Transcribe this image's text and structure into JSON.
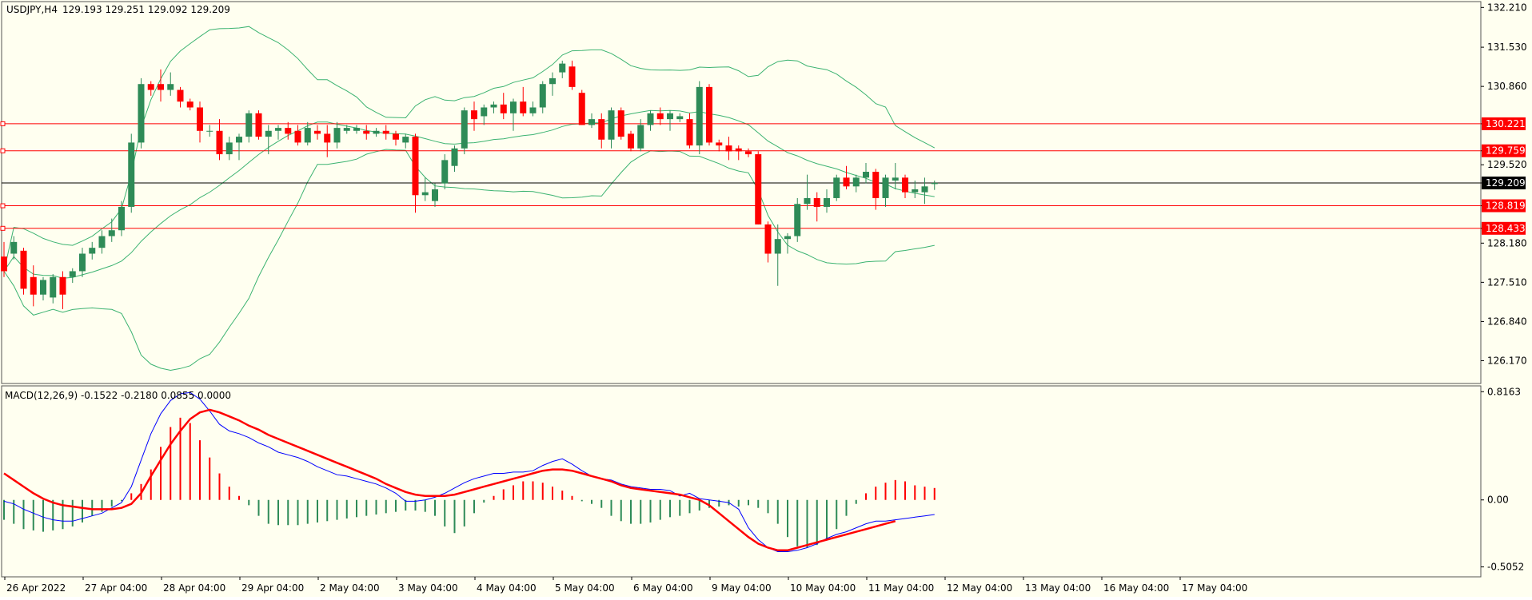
{
  "header": {
    "symbol_tf": "USDJPY,H4",
    "ohlc": "129.193 129.251 129.092 129.209",
    "macd_label": "MACD(12,26,9) -0.1522 -0.2180 0.0855 0.0000"
  },
  "colors": {
    "background": "#fffff0",
    "bull": "#2e8b57",
    "bear": "#ff0000",
    "bollinger": "#3cb371",
    "level_line": "#ff0000",
    "price_line": "#000000",
    "macd_line": "#0000ff",
    "signal_line": "#ff0000"
  },
  "chart_data": [
    {
      "type": "candlestick",
      "title": "USDJPY,H4",
      "ylim": [
        125.78,
        132.31
      ],
      "y_ticks": [
        "132.210",
        "131.530",
        "130.860",
        "130.221",
        "129.759",
        "129.520",
        "129.209",
        "128.819",
        "128.433",
        "128.180",
        "127.510",
        "126.840",
        "126.170"
      ],
      "x_ticks": [
        "26 Apr 2022",
        "27 Apr 04:00",
        "28 Apr 04:00",
        "29 Apr 04:00",
        "2 May 04:00",
        "3 May 04:00",
        "4 May 04:00",
        "5 May 04:00",
        "6 May 04:00",
        "9 May 04:00",
        "10 May 04:00",
        "11 May 04:00",
        "12 May 04:00",
        "13 May 04:00",
        "16 May 04:00",
        "17 May 04:00"
      ],
      "horizontal_levels": [
        {
          "label": "130.221",
          "value": 130.221
        },
        {
          "label": "129.759",
          "value": 129.759
        },
        {
          "label": "128.819",
          "value": 128.819
        },
        {
          "label": "128.433",
          "value": 128.433
        }
      ],
      "current_price": {
        "label": "129.209",
        "value": 129.209
      },
      "candles": [
        [
          127.95,
          128.2,
          127.6,
          127.7
        ],
        [
          128.0,
          128.3,
          127.9,
          128.2
        ],
        [
          128.05,
          128.1,
          127.3,
          127.4
        ],
        [
          127.6,
          127.8,
          127.1,
          127.3
        ],
        [
          127.3,
          127.6,
          127.2,
          127.55
        ],
        [
          127.25,
          127.65,
          127.15,
          127.6
        ],
        [
          127.6,
          127.7,
          127.05,
          127.3
        ],
        [
          127.6,
          127.75,
          127.5,
          127.7
        ],
        [
          127.7,
          128.1,
          127.6,
          128.0
        ],
        [
          128.0,
          128.2,
          127.9,
          128.1
        ],
        [
          128.1,
          128.4,
          128.0,
          128.3
        ],
        [
          128.3,
          128.6,
          128.2,
          128.4
        ],
        [
          128.4,
          128.9,
          128.3,
          128.8
        ],
        [
          128.8,
          130.05,
          128.7,
          129.9
        ],
        [
          129.9,
          131.0,
          129.8,
          130.9
        ],
        [
          130.9,
          130.95,
          130.7,
          130.8
        ],
        [
          130.9,
          131.15,
          130.6,
          130.8
        ],
        [
          130.8,
          131.1,
          130.7,
          130.9
        ],
        [
          130.8,
          130.85,
          130.5,
          130.6
        ],
        [
          130.6,
          130.65,
          130.45,
          130.5
        ],
        [
          130.5,
          130.6,
          129.9,
          130.1
        ],
        [
          130.1,
          130.2,
          130.0,
          130.1
        ],
        [
          130.1,
          130.3,
          129.6,
          129.7
        ],
        [
          129.7,
          130.0,
          129.6,
          129.9
        ],
        [
          129.9,
          130.05,
          129.6,
          130.0
        ],
        [
          130.0,
          130.45,
          129.9,
          130.4
        ],
        [
          130.4,
          130.45,
          129.95,
          130.0
        ],
        [
          130.0,
          130.2,
          129.7,
          130.1
        ],
        [
          130.1,
          130.2,
          129.95,
          130.15
        ],
        [
          130.15,
          130.25,
          129.95,
          130.05
        ],
        [
          130.1,
          130.2,
          129.85,
          129.9
        ],
        [
          129.9,
          130.25,
          129.85,
          130.15
        ],
        [
          130.1,
          130.2,
          129.95,
          130.05
        ],
        [
          130.05,
          130.2,
          129.65,
          129.9
        ],
        [
          129.9,
          130.25,
          129.8,
          130.15
        ],
        [
          130.1,
          130.2,
          130.05,
          130.15
        ],
        [
          130.1,
          130.2,
          130.05,
          130.15
        ],
        [
          130.1,
          130.2,
          129.95,
          130.05
        ],
        [
          130.05,
          130.15,
          130.0,
          130.1
        ],
        [
          130.1,
          130.2,
          129.95,
          130.05
        ],
        [
          130.05,
          130.1,
          129.85,
          129.95
        ],
        [
          129.9,
          130.05,
          129.8,
          130.0
        ],
        [
          130.0,
          130.05,
          128.7,
          129.0
        ],
        [
          129.0,
          129.3,
          128.9,
          129.05
        ],
        [
          128.9,
          129.2,
          128.8,
          129.1
        ],
        [
          129.2,
          129.7,
          129.1,
          129.6
        ],
        [
          129.5,
          129.85,
          129.4,
          129.8
        ],
        [
          129.8,
          130.5,
          129.7,
          130.45
        ],
        [
          130.45,
          130.6,
          130.1,
          130.3
        ],
        [
          130.35,
          130.55,
          130.2,
          130.5
        ],
        [
          130.5,
          130.6,
          130.4,
          130.55
        ],
        [
          130.55,
          130.75,
          130.3,
          130.4
        ],
        [
          130.4,
          130.65,
          130.1,
          130.6
        ],
        [
          130.6,
          130.85,
          130.35,
          130.4
        ],
        [
          130.4,
          130.6,
          130.35,
          130.5
        ],
        [
          130.5,
          130.95,
          130.4,
          130.9
        ],
        [
          130.9,
          131.1,
          130.7,
          131.0
        ],
        [
          131.1,
          131.3,
          131.0,
          131.25
        ],
        [
          131.2,
          131.3,
          130.8,
          130.85
        ],
        [
          130.75,
          130.8,
          130.2,
          130.2
        ],
        [
          130.2,
          130.4,
          130.15,
          130.3
        ],
        [
          130.3,
          130.4,
          129.8,
          129.95
        ],
        [
          129.95,
          130.5,
          129.8,
          130.45
        ],
        [
          130.45,
          130.5,
          129.95,
          130.0
        ],
        [
          130.05,
          130.1,
          129.75,
          129.8
        ],
        [
          129.8,
          130.3,
          129.75,
          130.2
        ],
        [
          130.2,
          130.45,
          130.1,
          130.4
        ],
        [
          130.4,
          130.5,
          130.2,
          130.3
        ],
        [
          130.3,
          130.45,
          130.1,
          130.4
        ],
        [
          130.3,
          130.4,
          130.25,
          130.35
        ],
        [
          130.3,
          130.4,
          129.8,
          129.85
        ],
        [
          129.85,
          130.95,
          129.7,
          130.85
        ],
        [
          130.85,
          130.9,
          129.85,
          129.9
        ],
        [
          129.9,
          129.95,
          129.75,
          129.85
        ],
        [
          129.85,
          130.0,
          129.6,
          129.75
        ],
        [
          129.8,
          129.85,
          129.6,
          129.75
        ],
        [
          129.75,
          129.8,
          129.65,
          129.7
        ],
        [
          129.7,
          129.75,
          128.5,
          128.5
        ],
        [
          128.5,
          128.55,
          127.85,
          128.0
        ],
        [
          128.0,
          128.5,
          127.45,
          128.25
        ],
        [
          128.25,
          128.35,
          128.0,
          128.3
        ],
        [
          128.3,
          128.95,
          128.2,
          128.85
        ],
        [
          128.85,
          129.35,
          128.75,
          128.95
        ],
        [
          128.95,
          129.05,
          128.55,
          128.8
        ],
        [
          128.8,
          129.1,
          128.7,
          128.95
        ],
        [
          128.95,
          129.35,
          128.9,
          129.3
        ],
        [
          129.3,
          129.5,
          129.1,
          129.15
        ],
        [
          129.15,
          129.35,
          129.05,
          129.3
        ],
        [
          129.3,
          129.55,
          129.2,
          129.4
        ],
        [
          129.4,
          129.45,
          128.75,
          128.95
        ],
        [
          128.95,
          129.35,
          128.8,
          129.3
        ],
        [
          129.25,
          129.55,
          129.1,
          129.3
        ],
        [
          129.3,
          129.35,
          128.95,
          129.05
        ],
        [
          129.05,
          129.25,
          128.95,
          129.1
        ],
        [
          129.05,
          129.3,
          128.85,
          129.15
        ],
        [
          129.19,
          129.25,
          129.09,
          129.21
        ]
      ]
    },
    {
      "type": "line",
      "title": "MACD(12,26,9) -0.1522 -0.2180 0.0855 0.0000",
      "ylim": [
        -0.58,
        0.86
      ],
      "y_ticks": [
        "0.8163",
        "0.00",
        "-0.5052"
      ],
      "series": [
        {
          "name": "MACD",
          "values": [
            -0.01,
            -0.03,
            -0.07,
            -0.1,
            -0.13,
            -0.15,
            -0.16,
            -0.16,
            -0.14,
            -0.12,
            -0.1,
            -0.06,
            -0.02,
            0.1,
            0.3,
            0.5,
            0.65,
            0.75,
            0.8,
            0.81,
            0.76,
            0.67,
            0.57,
            0.52,
            0.5,
            0.47,
            0.43,
            0.4,
            0.36,
            0.34,
            0.32,
            0.29,
            0.25,
            0.22,
            0.19,
            0.18,
            0.16,
            0.14,
            0.12,
            0.09,
            0.05,
            -0.01,
            -0.01,
            0.0,
            0.02,
            0.05,
            0.09,
            0.13,
            0.16,
            0.18,
            0.2,
            0.2,
            0.21,
            0.21,
            0.22,
            0.26,
            0.29,
            0.31,
            0.27,
            0.22,
            0.18,
            0.16,
            0.15,
            0.12,
            0.1,
            0.09,
            0.08,
            0.08,
            0.07,
            0.03,
            0.05,
            0.01,
            0.0,
            -0.01,
            -0.02,
            -0.07,
            -0.21,
            -0.3,
            -0.36,
            -0.39,
            -0.39,
            -0.38,
            -0.36,
            -0.33,
            -0.29,
            -0.26,
            -0.24,
            -0.21,
            -0.18,
            -0.16,
            -0.16,
            -0.15,
            -0.14,
            -0.13,
            -0.12,
            -0.11
          ]
        },
        {
          "name": "Signal",
          "values": [
            0.2,
            0.15,
            0.1,
            0.05,
            0.01,
            -0.02,
            -0.04,
            -0.05,
            -0.06,
            -0.07,
            -0.07,
            -0.07,
            -0.06,
            -0.03,
            0.05,
            0.18,
            0.3,
            0.42,
            0.52,
            0.61,
            0.66,
            0.68,
            0.66,
            0.63,
            0.6,
            0.56,
            0.53,
            0.49,
            0.46,
            0.43,
            0.4,
            0.37,
            0.34,
            0.31,
            0.28,
            0.25,
            0.22,
            0.19,
            0.16,
            0.12,
            0.09,
            0.06,
            0.04,
            0.03,
            0.03,
            0.03,
            0.04,
            0.06,
            0.08,
            0.1,
            0.12,
            0.14,
            0.16,
            0.18,
            0.2,
            0.22,
            0.23,
            0.23,
            0.22,
            0.2,
            0.18,
            0.16,
            0.14,
            0.11,
            0.09,
            0.08,
            0.07,
            0.06,
            0.05,
            0.04,
            0.02,
            0.0,
            -0.04,
            -0.1,
            -0.16,
            -0.22,
            -0.28,
            -0.33,
            -0.36,
            -0.38,
            -0.38,
            -0.36,
            -0.34,
            -0.32,
            -0.3,
            -0.28,
            -0.26,
            -0.24,
            -0.22,
            -0.2,
            -0.18,
            -0.16
          ]
        },
        {
          "name": "Histogram",
          "values": [
            -0.15,
            -0.18,
            -0.22,
            -0.23,
            -0.24,
            -0.23,
            -0.22,
            -0.2,
            -0.17,
            -0.12,
            -0.09,
            -0.05,
            -0.01,
            0.05,
            0.12,
            0.23,
            0.4,
            0.55,
            0.62,
            0.58,
            0.45,
            0.32,
            0.2,
            0.1,
            0.03,
            -0.04,
            -0.12,
            -0.18,
            -0.19,
            -0.19,
            -0.19,
            -0.18,
            -0.17,
            -0.16,
            -0.15,
            -0.14,
            -0.13,
            -0.12,
            -0.11,
            -0.1,
            -0.09,
            -0.08,
            -0.08,
            -0.09,
            -0.12,
            -0.2,
            -0.25,
            -0.2,
            -0.1,
            -0.02,
            0.03,
            0.08,
            0.11,
            0.14,
            0.14,
            0.13,
            0.1,
            0.07,
            0.03,
            -0.01,
            -0.03,
            -0.06,
            -0.12,
            -0.16,
            -0.18,
            -0.18,
            -0.17,
            -0.15,
            -0.13,
            -0.12,
            -0.1,
            -0.08,
            -0.06,
            -0.05,
            -0.04,
            -0.05,
            -0.04,
            -0.06,
            -0.1,
            -0.18,
            -0.28,
            -0.35,
            -0.36,
            -0.34,
            -0.3,
            -0.22,
            -0.12,
            -0.03,
            0.05,
            0.1,
            0.13,
            0.15,
            0.14,
            0.11,
            0.1,
            0.09
          ]
        }
      ]
    }
  ]
}
